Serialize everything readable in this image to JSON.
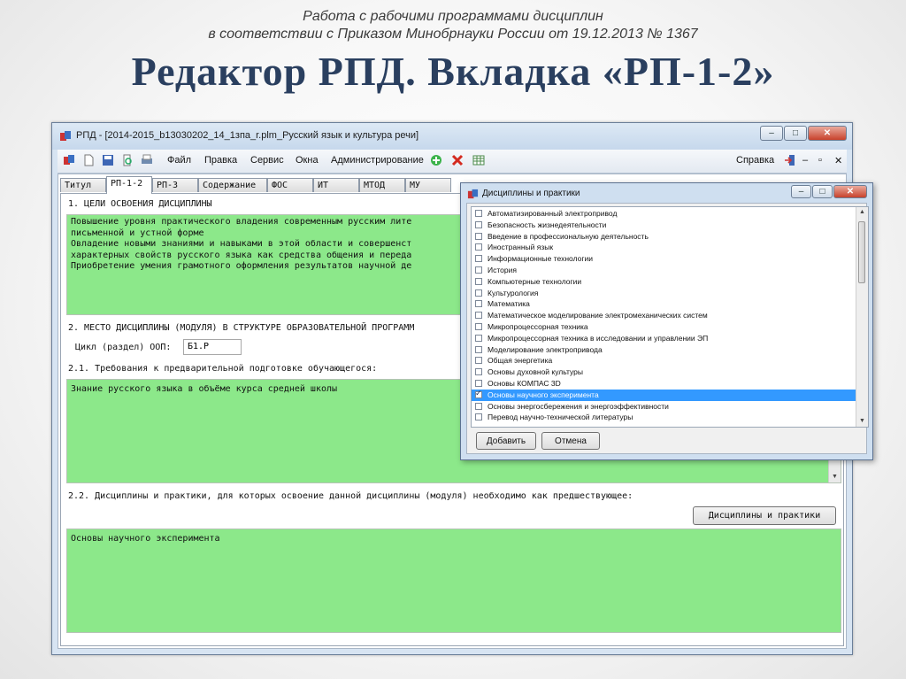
{
  "slide": {
    "subtitle_line1": "Работа с рабочими программами дисциплин",
    "subtitle_line2": "в соответствии с Приказом Минобрнауки России от 19.12.2013 № 1367",
    "title": "Редактор РПД. Вкладка «РП-1-2»"
  },
  "window": {
    "title": "РПД - [2014-2015_b13030202_14_1зпа_r.plm_Русский язык и культура речи]",
    "controls": {
      "minimize": "–",
      "maximize": "□",
      "close": "✕"
    }
  },
  "menubar": {
    "items": [
      "Файл",
      "Правка",
      "Сервис",
      "Окна",
      "Администрирование"
    ],
    "help": "Справка",
    "mdi_controls": [
      "–",
      "▫",
      "✕"
    ]
  },
  "tabs": [
    "Титул",
    "РП-1-2",
    "РП-3",
    "Содержание",
    "ФОС",
    "ИТ",
    "МТОД",
    "МУ"
  ],
  "active_tab": "РП-1-2",
  "content": {
    "section1_heading": "1. ЦЕЛИ ОСВОЕНИЯ ДИСЦИПЛИНЫ",
    "goals_lines": [
      "Повышение уровня практического владения современным русским лите",
      "письменной и устной форме",
      "Овладение новыми знаниями и навыками в этой области и совершенст",
      "характерных свойств русского языка как средства общения и переда",
      "Приобретение умения грамотного оформления результатов научной де"
    ],
    "section2_heading": "2. МЕСТО ДИСЦИПЛИНЫ (МОДУЛЯ) В СТРУКТУРЕ ОБРАЗОВАТЕЛЬНОЙ ПРОГРАММ",
    "cycle_label": "Цикл (раздел) ООП:",
    "cycle_value": "Б1.Р",
    "req_heading": "2.1. Требования к предварительной подготовке обучающегося:",
    "req_text": "Знание русского языка в объёме курса средней школы",
    "prev_heading": "2.2. Дисциплины и практики, для которых освоение данной дисциплины (модуля) необходимо как предшествующее:",
    "prev_button": "Дисциплины и практики",
    "prev_text": "Основы научного эксперимента"
  },
  "dialog": {
    "title": "Дисциплины и практики",
    "items": [
      {
        "label": "Автоматизированный электропривод",
        "checked": false
      },
      {
        "label": "Безопасность жизнедеятельности",
        "checked": false
      },
      {
        "label": "Введение в профессиональную деятельность",
        "checked": false
      },
      {
        "label": "Иностранный язык",
        "checked": false
      },
      {
        "label": "Информационные технологии",
        "checked": false
      },
      {
        "label": "История",
        "checked": false
      },
      {
        "label": "Компьютерные технологии",
        "checked": false
      },
      {
        "label": "Культурология",
        "checked": false
      },
      {
        "label": "Математика",
        "checked": false
      },
      {
        "label": "Математическое моделирование электромеханических систем",
        "checked": false
      },
      {
        "label": "Микропроцессорная техника",
        "checked": false
      },
      {
        "label": "Микропроцессорная техника в исследовании и управлении ЭП",
        "checked": false
      },
      {
        "label": "Моделирование электропривода",
        "checked": false
      },
      {
        "label": "Общая энергетика",
        "checked": false
      },
      {
        "label": "Основы духовной культуры",
        "checked": false
      },
      {
        "label": "Основы КОМПАС 3D",
        "checked": false
      },
      {
        "label": "Основы научного эксперимента",
        "checked": true,
        "selected": true
      },
      {
        "label": "Основы энергосбережения и энергоэффективности",
        "checked": false
      },
      {
        "label": "Перевод научно-технической литературы",
        "checked": false
      }
    ],
    "add_button": "Добавить",
    "cancel_button": "Отмена"
  },
  "colors": {
    "field_green": "#8ce88a",
    "selection": "#3399ff",
    "title_blue": "#2a3f5f"
  }
}
